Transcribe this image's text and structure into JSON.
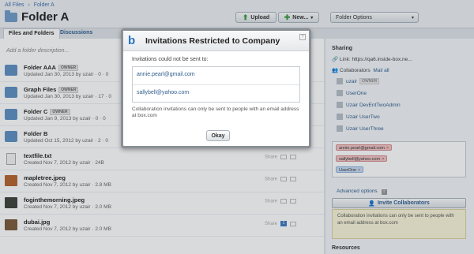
{
  "breadcrumb": {
    "items": [
      "All Files",
      "Folder A"
    ],
    "separator": "›"
  },
  "header": {
    "title": "Folder A",
    "upload_label": "Upload",
    "new_label": "New...",
    "folder_options_label": "Folder Options"
  },
  "tabs": [
    {
      "label": "Files and Folders",
      "active": true
    },
    {
      "label": "Discussions",
      "active": false
    }
  ],
  "list": {
    "add_description_placeholder": "Add a folder description...",
    "share_label": "Share",
    "items": [
      {
        "name": "Folder AAA",
        "owner": "OWNER",
        "meta": "Updated Jan 30, 2013 by uzair  ·  0  ·  0",
        "type": "folder"
      },
      {
        "name": "Graph Files",
        "owner": "OWNER",
        "meta": "Updated Jan 30, 2013 by uzair  ·  17  ·  0",
        "type": "folder"
      },
      {
        "name": "Folder C",
        "owner": "OWNER",
        "meta": "Updated Jan 9, 2013 by uzair  ·  0  ·  0",
        "type": "folder"
      },
      {
        "name": "Folder B",
        "owner": "",
        "meta": "Updated Oct 15, 2012 by uzair  ·  2  ·  0",
        "type": "folder"
      },
      {
        "name": "textfile.txt",
        "owner": "",
        "meta": "Created Nov 7, 2012 by uzair  ·  24B",
        "type": "file"
      },
      {
        "name": "mapletree.jpeg",
        "owner": "",
        "meta": "Created Nov 7, 2012 by uzair  ·  2.8 MB",
        "type": "img",
        "color": "#b5652b"
      },
      {
        "name": "foginthemorning.jpeg",
        "owner": "",
        "meta": "Created Nov 7, 2012 by uzair  ·  2.0 MB",
        "type": "img",
        "color": "#3e4237"
      },
      {
        "name": "dubai.jpg",
        "owner": "",
        "meta": "Created Nov 7, 2012 by uzair  ·  2.0 MB",
        "type": "img",
        "color": "#7c5a39"
      }
    ]
  },
  "sidebar": {
    "sharing_heading": "Sharing",
    "link_label": "Link: https://qa6.inside-box.ne...",
    "collaborators_label": "Collaborators",
    "mail_all_label": "Mail all",
    "collaborators": [
      {
        "name": "uzair",
        "owner": "OWNER"
      },
      {
        "name": "UserOne",
        "owner": ""
      },
      {
        "name": "Uzair DevEntTwoAdmin",
        "owner": ""
      },
      {
        "name": "Uzair UserTwo",
        "owner": ""
      },
      {
        "name": "Uzair UserThree",
        "owner": ""
      }
    ],
    "pending_invites": [
      {
        "label": "annie.pearl@gmail.com",
        "style": "red"
      },
      {
        "label": "sallybell@yahoo.com",
        "style": "red"
      },
      {
        "label": "UserOne",
        "style": "blue"
      }
    ],
    "advanced_options_label": "Advanced options",
    "invite_button_label": "Invite Collaborators",
    "warning_text": "Collaboration invitations can only be sent to people with an email address at box.com",
    "resources_heading": "Resources"
  },
  "modal": {
    "title": "Invitations Restricted to Company",
    "close_icon_label": "?",
    "not_sent_label": "Invitations could not be sent to:",
    "emails": [
      "annie.pearl@gmail.com",
      "sallybell@yahoo.com"
    ],
    "note": "Collaboration invitations can only be sent to people with an email address at box.com",
    "okay_label": "Okay"
  },
  "colors": {
    "accent": "#2f5d8f",
    "folder": "#5f8fc2",
    "upload_icon": "#3a9b3a"
  }
}
